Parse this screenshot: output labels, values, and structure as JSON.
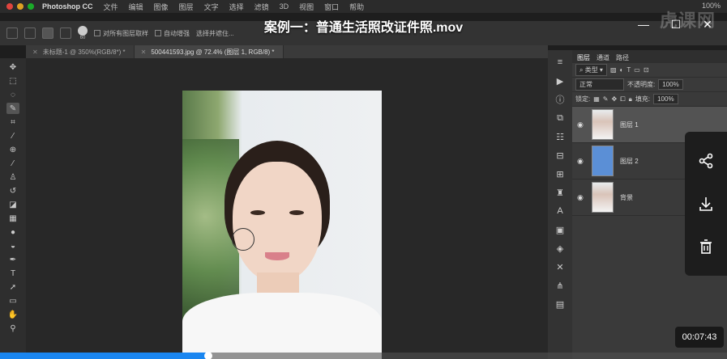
{
  "menubar": {
    "app": "Photoshop CC",
    "items": [
      "文件",
      "编辑",
      "图像",
      "图层",
      "文字",
      "选择",
      "滤镜",
      "3D",
      "视图",
      "窗口",
      "帮助"
    ],
    "battery": "100%"
  },
  "video": {
    "title": "案例一：普通生活照改证件照.mov",
    "watermark": "虎课网",
    "time": "00:07:43",
    "progress": 0.286
  },
  "options_bar": {
    "brush_size": "60",
    "sample_all_layers": "对所有图层取样",
    "auto_enhance": "自动增强",
    "select_and_mask": "选择并遮住..."
  },
  "tabs": [
    {
      "label": "未标题-1 @ 350%(RGB/8*) *",
      "active": false
    },
    {
      "label": "500441593.jpg @ 72.4% (图层 1, RGB/8) *",
      "active": true
    }
  ],
  "layers_panel": {
    "tabs": [
      "图层",
      "通道",
      "路径"
    ],
    "filter": "类型",
    "blend_mode": "正常",
    "opacity_label": "不透明度:",
    "opacity": "100%",
    "lock_label": "锁定:",
    "fill_label": "填充:",
    "fill": "100%",
    "layers": [
      {
        "name": "图层 1",
        "thumb": "face",
        "selected": true
      },
      {
        "name": "图层 2",
        "thumb": "blue",
        "selected": false
      },
      {
        "name": "背景",
        "thumb": "face",
        "selected": false
      }
    ]
  },
  "colors": {
    "accent": "#1a86f0",
    "layer_blue": "#5b8fd6"
  }
}
